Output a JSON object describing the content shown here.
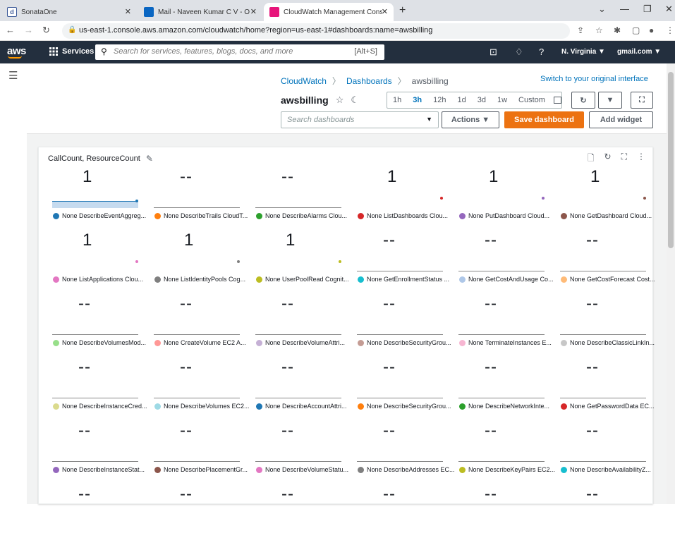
{
  "browser": {
    "tabs": [
      {
        "label": "SonataOne",
        "color": "#3b5998"
      },
      {
        "label": "Mail - Naveen Kumar C V - Outlo",
        "color": "#0a66c2"
      },
      {
        "label": "CloudWatch Management Conso",
        "color": "#e7157b"
      }
    ],
    "url": "us-east-1.console.aws.amazon.com/cloudwatch/home?region=us-east-1#dashboards:name=awsbilling"
  },
  "awsnav": {
    "logo": "aws",
    "services": "Services",
    "search_placeholder": "Search for services, features, blogs, docs, and more",
    "shortcut": "[Alt+S]",
    "region": "N. Virginia ▼",
    "account": "gmail.com ▼"
  },
  "breadcrumb": {
    "root": "CloudWatch",
    "mid": "Dashboards",
    "current": "awsbilling"
  },
  "switch_link": "Switch to your original interface",
  "dashboard": {
    "title": "awsbilling",
    "search_placeholder": "Search dashboards",
    "actions": "Actions ▼",
    "save": "Save dashboard",
    "add": "Add widget"
  },
  "time_ranges": [
    "1h",
    "3h",
    "12h",
    "1d",
    "3d",
    "1w",
    "Custom"
  ],
  "selected_range": "3h",
  "widget": {
    "title": "CallCount, ResourceCount",
    "metrics": [
      {
        "value": "1",
        "label": "None DescribeEventAggreg...",
        "color": "#1f77b4",
        "spark": "area"
      },
      {
        "value": "--",
        "label": "None DescribeTrails CloudT...",
        "color": "#ff7f0e",
        "spark": "line"
      },
      {
        "value": "--",
        "label": "None DescribeAlarms Clou...",
        "color": "#2ca02c",
        "spark": "line"
      },
      {
        "value": "1",
        "label": "None ListDashboards Clou...",
        "color": "#d62728",
        "spark": "dot"
      },
      {
        "value": "1",
        "label": "None PutDashboard Cloud...",
        "color": "#9467bd",
        "spark": "dot"
      },
      {
        "value": "1",
        "label": "None GetDashboard Cloud...",
        "color": "#8c564b",
        "spark": "dot"
      },
      {
        "value": "1",
        "label": "None ListApplications Clou...",
        "color": "#e377c2",
        "spark": "dot"
      },
      {
        "value": "1",
        "label": "None ListIdentityPools Cog...",
        "color": "#7f7f7f",
        "spark": "dot"
      },
      {
        "value": "1",
        "label": "None UserPoolRead Cognit...",
        "color": "#bcbd22",
        "spark": "dot"
      },
      {
        "value": "--",
        "label": "None GetEnrollmentStatus ...",
        "color": "#17becf",
        "spark": "line"
      },
      {
        "value": "--",
        "label": "None GetCostAndUsage Co...",
        "color": "#aec7e8",
        "spark": "line"
      },
      {
        "value": "--",
        "label": "None GetCostForecast Cost...",
        "color": "#ffbb78",
        "spark": "line"
      },
      {
        "value": "--",
        "label": "None DescribeVolumesMod...",
        "color": "#98df8a",
        "spark": "line"
      },
      {
        "value": "--",
        "label": "None CreateVolume EC2 A...",
        "color": "#ff9896",
        "spark": "line"
      },
      {
        "value": "--",
        "label": "None DescribeVolumeAttri...",
        "color": "#c5b0d5",
        "spark": "line"
      },
      {
        "value": "--",
        "label": "None DescribeSecurityGrou...",
        "color": "#c49c94",
        "spark": "line"
      },
      {
        "value": "--",
        "label": "None TerminateInstances E...",
        "color": "#f7b6d2",
        "spark": "line"
      },
      {
        "value": "--",
        "label": "None DescribeClassicLinkIn...",
        "color": "#c7c7c7",
        "spark": "line"
      },
      {
        "value": "--",
        "label": "None DescribeInstanceCred...",
        "color": "#dbdb8d",
        "spark": "line"
      },
      {
        "value": "--",
        "label": "None DescribeVolumes EC2...",
        "color": "#9edae5",
        "spark": "line"
      },
      {
        "value": "--",
        "label": "None DescribeAccountAttri...",
        "color": "#1f77b4",
        "spark": "line"
      },
      {
        "value": "--",
        "label": "None DescribeSecurityGrou...",
        "color": "#ff7f0e",
        "spark": "line"
      },
      {
        "value": "--",
        "label": "None DescribeNetworkInte...",
        "color": "#2ca02c",
        "spark": "line"
      },
      {
        "value": "--",
        "label": "None GetPasswordData EC...",
        "color": "#d62728",
        "spark": "line"
      },
      {
        "value": "--",
        "label": "None DescribeInstanceStat...",
        "color": "#9467bd",
        "spark": "line"
      },
      {
        "value": "--",
        "label": "None DescribePlacementGr...",
        "color": "#8c564b",
        "spark": "line"
      },
      {
        "value": "--",
        "label": "None DescribeVolumeStatu...",
        "color": "#e377c2",
        "spark": "line"
      },
      {
        "value": "--",
        "label": "None DescribeAddresses EC...",
        "color": "#7f7f7f",
        "spark": "line"
      },
      {
        "value": "--",
        "label": "None DescribeKeyPairs EC2...",
        "color": "#bcbd22",
        "spark": "line"
      },
      {
        "value": "--",
        "label": "None DescribeAvailabilityZ...",
        "color": "#17becf",
        "spark": "line"
      },
      {
        "value": "--",
        "label": "",
        "color": "",
        "spark": "none"
      },
      {
        "value": "--",
        "label": "",
        "color": "",
        "spark": "none"
      },
      {
        "value": "--",
        "label": "",
        "color": "",
        "spark": "none"
      },
      {
        "value": "--",
        "label": "",
        "color": "",
        "spark": "none"
      },
      {
        "value": "--",
        "label": "",
        "color": "",
        "spark": "none"
      },
      {
        "value": "--",
        "label": "",
        "color": "",
        "spark": "none"
      }
    ]
  }
}
